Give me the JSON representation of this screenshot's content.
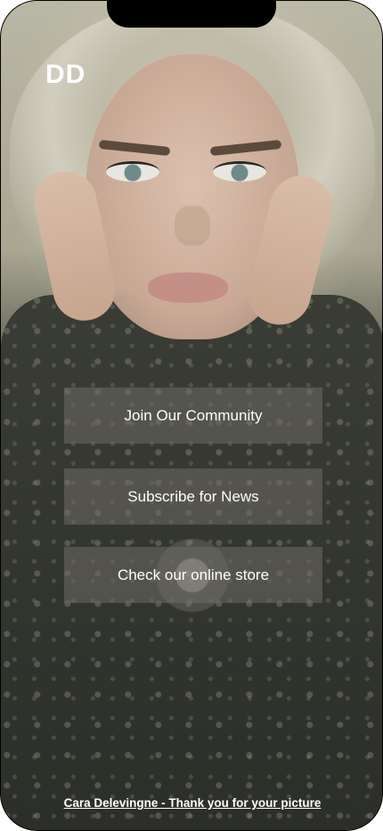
{
  "header": {
    "logo_text": "DD"
  },
  "buttons": [
    {
      "label": "Join Our Community"
    },
    {
      "label": "Subscribe for News"
    },
    {
      "label": "Check our online store"
    }
  ],
  "footer": {
    "credit_text": "Cara Delevingne - Thank you for your picture"
  },
  "colors": {
    "button_bg": "#6e6c64",
    "text": "#ffffff",
    "frame": "#000000"
  }
}
